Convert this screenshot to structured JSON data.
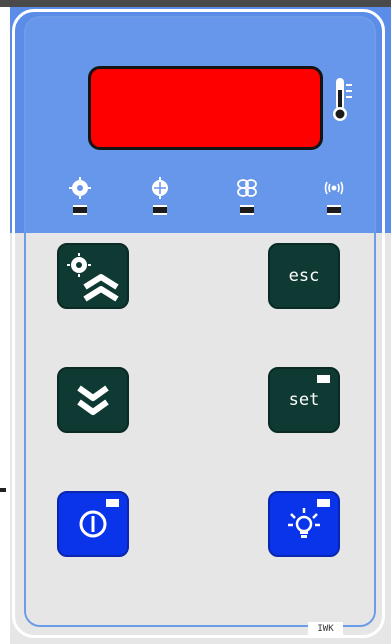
{
  "panel": {
    "buttons": {
      "esc_label": "esc",
      "set_label": "set"
    },
    "indicators": [
      {
        "icon": "compressor-icon"
      },
      {
        "icon": "defrost-icon"
      },
      {
        "icon": "fan-icon"
      },
      {
        "icon": "alarm-icon"
      }
    ],
    "brand_tag": "IWK",
    "colors": {
      "display": "#ff0000",
      "panel_blue": "#6797ea",
      "button_dark": "#0f3a33",
      "button_blue": "#0a34ea"
    }
  }
}
